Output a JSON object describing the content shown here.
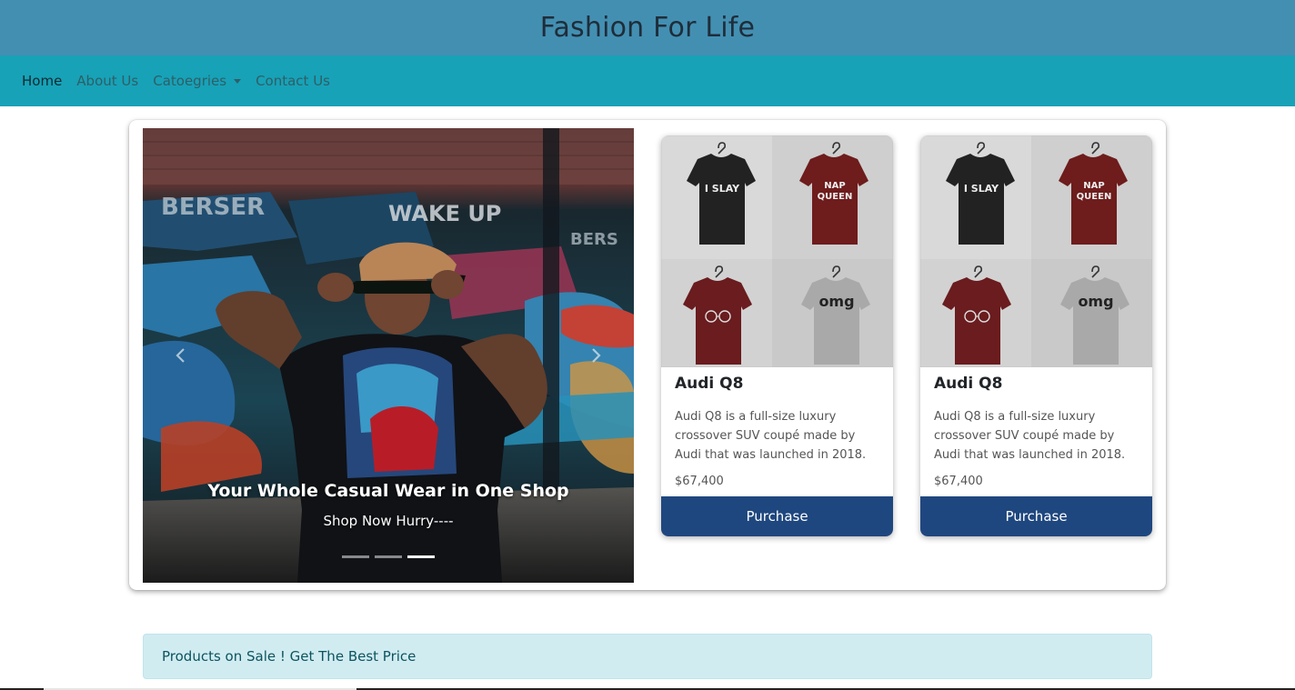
{
  "header": {
    "title": "Fashion For Life"
  },
  "nav": {
    "home": "Home",
    "about": "About Us",
    "categories": "Catoegries",
    "contact": "Contact Us"
  },
  "carousel": {
    "title": "Your Whole Casual Wear in One Shop",
    "subtitle": "Shop Now Hurry----",
    "slide_count": 3,
    "active_slide": 3,
    "graffiti_text": [
      "BERSER",
      "WAKE UP",
      "BERS"
    ]
  },
  "cards": [
    {
      "title": "Audi Q8",
      "text": "Audi Q8 is a full-size luxury crossover SUV coupé made by Audi that was launched in 2018.",
      "price": "$67,400",
      "button": "Purchase",
      "shirt_prints": [
        "I SLAY",
        "NAP",
        "QUEEN",
        "omg"
      ]
    },
    {
      "title": "Audi Q8",
      "text": "Audi Q8 is a full-size luxury crossover SUV coupé made by Audi that was launched in 2018.",
      "price": "$67,400",
      "button": "Purchase",
      "shirt_prints": [
        "I SLAY",
        "NAP",
        "QUEEN",
        "omg"
      ]
    }
  ],
  "alert": {
    "text": "Products on Sale ! Get The Best Price"
  },
  "colors": {
    "header_bg": "#438fb2",
    "navbar_bg": "#17a2b8",
    "button_bg": "#1f477f",
    "alert_bg": "#d1ecf1"
  },
  "icons": [
    "chevron-left-icon",
    "chevron-right-icon",
    "dropdown-caret-icon"
  ]
}
